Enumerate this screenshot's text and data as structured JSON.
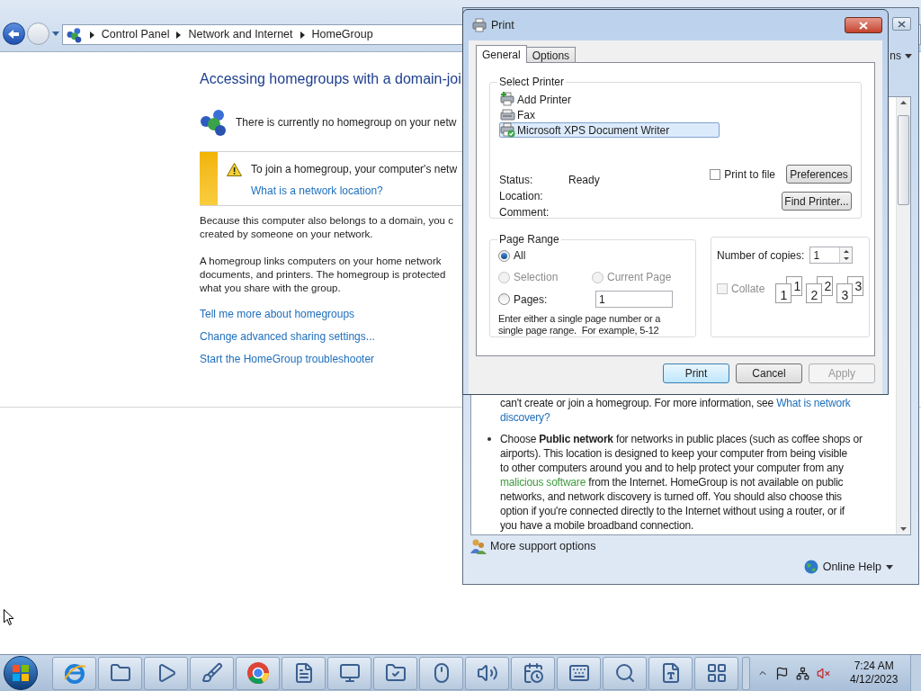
{
  "explorer": {
    "breadcrumb": [
      "Control Panel",
      "Network and Internet",
      "HomeGroup"
    ],
    "heading": "Accessing homegroups with a domain-joi",
    "status_text": "There is currently no homegroup on your netw",
    "notice": {
      "text": "To join a homegroup, your computer's netw",
      "link": "What is a network location?"
    },
    "paragraphs": [
      {
        "lines": [
          "Because this computer also belongs to a domain, you c",
          "created by someone on your network."
        ]
      },
      {
        "lines": [
          "A homegroup links computers on your home network",
          "documents, and printers. The homegroup is protected",
          "what you share with the group."
        ]
      }
    ],
    "links": [
      "Tell me more about homegroups",
      "Change advanced sharing settings...",
      "Start the HomeGroup troubleshooter"
    ]
  },
  "help_window": {
    "toolbar_text": "ns",
    "paragraphs": [
      {
        "bullet": false,
        "lines": [
          [
            {
              "kind": "text",
              "text": "can't create or join a homegroup. For more information, see "
            },
            {
              "kind": "link",
              "text": "What is network"
            }
          ],
          [
            {
              "kind": "link",
              "text": "discovery?"
            }
          ]
        ]
      },
      {
        "bullet": true,
        "lines": [
          [
            {
              "kind": "text",
              "text": "Choose "
            },
            {
              "kind": "bold",
              "text": "Public network"
            },
            {
              "kind": "text",
              "text": " for networks in public places (such as coffee shops or"
            }
          ],
          [
            {
              "kind": "text",
              "text": "airports). This location is designed to keep your computer from being visible"
            }
          ],
          [
            {
              "kind": "text",
              "text": "to other computers around you and to help protect your computer from any"
            }
          ],
          [
            {
              "kind": "term",
              "text": "malicious software"
            },
            {
              "kind": "text",
              "text": " from the Internet. HomeGroup is not available on public"
            }
          ],
          [
            {
              "kind": "text",
              "text": "networks, and network discovery is turned off. You should also choose this"
            }
          ],
          [
            {
              "kind": "text",
              "text": "option if you're connected directly to the Internet without using a router, or if"
            }
          ],
          [
            {
              "kind": "text",
              "text": "you have a mobile broadband connection."
            }
          ]
        ]
      }
    ],
    "support_link": "More support options",
    "online_help": "Online Help"
  },
  "print_dialog": {
    "title": "Print",
    "tabs": [
      {
        "label": "General",
        "selected": true
      },
      {
        "label": "Options",
        "selected": false
      }
    ],
    "printer_group": {
      "legend": "Select Printer",
      "printers": [
        {
          "name": "Add Printer",
          "kind": "add",
          "selected": false
        },
        {
          "name": "Fax",
          "kind": "fax",
          "selected": false
        },
        {
          "name": "Microsoft XPS Document Writer",
          "kind": "default",
          "selected": true
        }
      ],
      "fields": [
        {
          "label": "Status:",
          "value": "Ready"
        },
        {
          "label": "Location:"
        },
        {
          "label": "Comment:"
        }
      ],
      "print_to_file": {
        "label": "Print to file",
        "checked": false
      },
      "buttons": [
        "Preferences",
        "Find Printer..."
      ]
    },
    "page_range": {
      "legend": "Page Range",
      "options": [
        {
          "label": "All",
          "selected": true,
          "disabled": false
        },
        {
          "label": "Selection",
          "selected": false,
          "disabled": true
        },
        {
          "label": "Current Page",
          "selected": false,
          "disabled": true
        },
        {
          "label": "Pages:",
          "selected": false,
          "disabled": false
        }
      ],
      "pages_value": "1",
      "hint": "Enter either a single page number or a single page range.  For example, 5-12"
    },
    "copies": {
      "label": "Number of copies:",
      "value": "1",
      "collate": {
        "label": "Collate",
        "checked": false,
        "disabled": true
      },
      "stacks": [
        [
          "1",
          "1"
        ],
        [
          "2",
          "2"
        ],
        [
          "3",
          "3"
        ]
      ]
    },
    "buttons": [
      {
        "label": "Print",
        "default": true,
        "disabled": false
      },
      {
        "label": "Cancel",
        "default": false,
        "disabled": false
      },
      {
        "label": "Apply",
        "default": false,
        "disabled": true
      }
    ]
  },
  "taskbar": {
    "time": "7:24 AM",
    "date": "4/12/2023"
  }
}
